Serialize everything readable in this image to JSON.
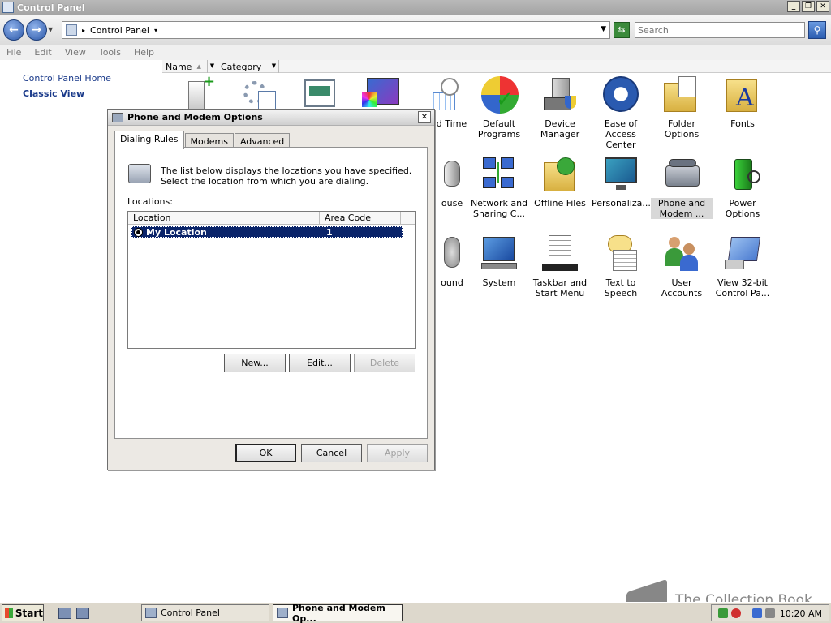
{
  "window": {
    "title": "Control Panel",
    "minimize": "_",
    "restore": "❐",
    "close": "✕"
  },
  "nav": {
    "back": "←",
    "forward": "→",
    "breadcrumb": "Control Panel",
    "search_placeholder": "Search",
    "search_glyph": "⚲",
    "refresh_glyph": "⇆"
  },
  "menu": [
    "File",
    "Edit",
    "View",
    "Tools",
    "Help"
  ],
  "left_pane": {
    "home": "Control Panel Home",
    "classic": "Classic View"
  },
  "columns": {
    "name": "Name",
    "category": "Category"
  },
  "items": [
    {
      "label": "",
      "icon": "add-hardware-icon"
    },
    {
      "label": "",
      "icon": "administrative-tools-icon"
    },
    {
      "label": "",
      "icon": "autoplay-icon"
    },
    {
      "label": "",
      "icon": "color-management-icon"
    },
    {
      "label": "nd Time",
      "icon": "date-time-icon"
    },
    {
      "label": "Default Programs",
      "icon": "default-programs-icon"
    },
    {
      "label": "Device Manager",
      "icon": "device-manager-icon"
    },
    {
      "label": "Ease of Access Center",
      "icon": "ease-of-access-icon"
    },
    {
      "label": "Folder Options",
      "icon": "folder-options-icon"
    },
    {
      "label": "Fonts",
      "icon": "fonts-icon"
    },
    {
      "label": "ouse",
      "icon": "mouse-icon"
    },
    {
      "label": "Network and Sharing C...",
      "icon": "network-sharing-icon"
    },
    {
      "label": "Offline Files",
      "icon": "offline-files-icon"
    },
    {
      "label": "Personaliza...",
      "icon": "personalization-icon"
    },
    {
      "label": "Phone and Modem ...",
      "icon": "phone-modem-icon"
    },
    {
      "label": "Power Options",
      "icon": "power-options-icon"
    },
    {
      "label": "ound",
      "icon": "sound-icon"
    },
    {
      "label": "System",
      "icon": "system-icon"
    },
    {
      "label": "Taskbar and Start Menu",
      "icon": "taskbar-start-icon"
    },
    {
      "label": "Text to Speech",
      "icon": "text-to-speech-icon"
    },
    {
      "label": "User Accounts",
      "icon": "user-accounts-icon"
    },
    {
      "label": "View 32-bit Control Pa...",
      "icon": "view-32bit-icon"
    }
  ],
  "dialog": {
    "title": "Phone and Modem Options",
    "close": "✕",
    "tabs": [
      "Dialing Rules",
      "Modems",
      "Advanced"
    ],
    "description": "The list below displays the locations you have specified. Select the location from which you are dialing.",
    "locations_label": "Locations:",
    "list_headers": {
      "location": "Location",
      "area_code": "Area Code"
    },
    "rows": [
      {
        "location": "My Location",
        "area_code": "1"
      }
    ],
    "buttons": {
      "new": "New...",
      "edit": "Edit...",
      "delete": "Delete",
      "ok": "OK",
      "cancel": "Cancel",
      "apply": "Apply"
    }
  },
  "taskbar": {
    "start": "Start",
    "tasks": [
      "Control Panel",
      "Phone and Modem Op..."
    ],
    "clock": "10:20 AM"
  },
  "watermark": "The Collection Book"
}
